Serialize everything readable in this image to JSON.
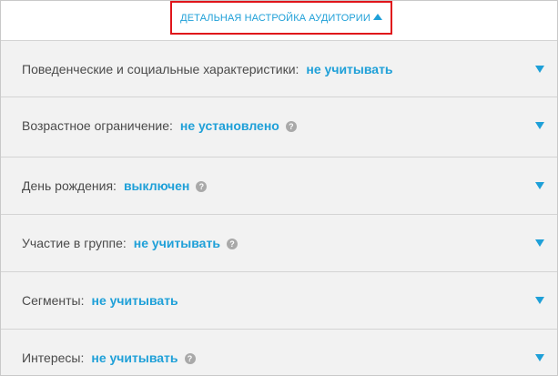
{
  "toggle": {
    "label": "ДЕТАЛЬНАЯ НАСТРОЙКА АУДИТОРИИ",
    "icon": "triangle-up-icon"
  },
  "rows": [
    {
      "label": "Поведенческие и социальные характеристики:",
      "value": "не учитывать",
      "help": false
    },
    {
      "label": "Возрастное ограничение:",
      "value": "не установлено",
      "help": true
    },
    {
      "label": "День рождения:",
      "value": "выключен",
      "help": true
    },
    {
      "label": "Участие в группе:",
      "value": "не учитывать",
      "help": true
    },
    {
      "label": "Сегменты:",
      "value": "не учитывать",
      "help": false
    },
    {
      "label": "Интересы:",
      "value": "не учитывать",
      "help": true
    }
  ],
  "help_glyph": "?",
  "colors": {
    "accent": "#1fa0d8",
    "highlight_border": "#e0151b",
    "text": "#4a4a4a",
    "row_bg": "#f2f2f2",
    "help_bg": "#a9a9a9"
  }
}
